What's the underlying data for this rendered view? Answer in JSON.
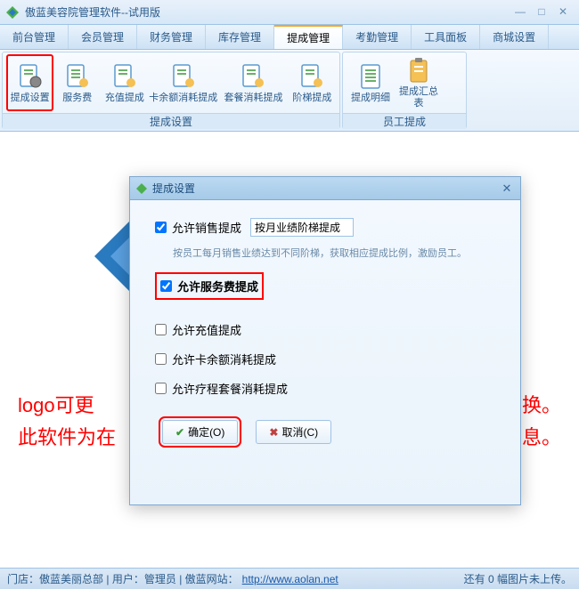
{
  "app": {
    "title": "傲蓝美容院管理软件--试用版"
  },
  "menu": {
    "tabs": [
      "前台管理",
      "会员管理",
      "财务管理",
      "库存管理",
      "提成管理",
      "考勤管理",
      "工具面板",
      "商城设置"
    ],
    "active": 4
  },
  "ribbon": {
    "group1": {
      "label": "提成设置",
      "items": [
        "提成设置",
        "服务费",
        "充值提成",
        "卡余额消耗提成",
        "套餐消耗提成",
        "阶梯提成"
      ]
    },
    "group2": {
      "label": "员工提成",
      "items": [
        "提成明细",
        "提成汇总表"
      ]
    }
  },
  "bg": {
    "line1a": "logo可更",
    "line1b": "换。",
    "line2a": "此软件为在",
    "line2b": "息。"
  },
  "dialog": {
    "title": "提成设置",
    "allow_sales": {
      "label": "允许销售提成",
      "checked": true
    },
    "sales_mode": "按月业绩阶梯提成",
    "hint": "按员工每月销售业绩达到不同阶梯，获取相应提成比例，激励员工。",
    "allow_service": {
      "label": "允许服务费提成",
      "checked": true
    },
    "allow_recharge": {
      "label": "允许充值提成",
      "checked": false
    },
    "allow_cardcons": {
      "label": "允许卡余额消耗提成",
      "checked": false
    },
    "allow_course": {
      "label": "允许疗程套餐消耗提成",
      "checked": false
    },
    "ok": "确定(O)",
    "cancel": "取消(C)"
  },
  "status": {
    "store_label": "门店：",
    "store": "傲蓝美丽总部",
    "user_label": "用户：",
    "user": "管理员",
    "site_label": "傲蓝网站：",
    "site_url": "http://www.aolan.net",
    "right": "还有 0 幅图片未上传。"
  }
}
